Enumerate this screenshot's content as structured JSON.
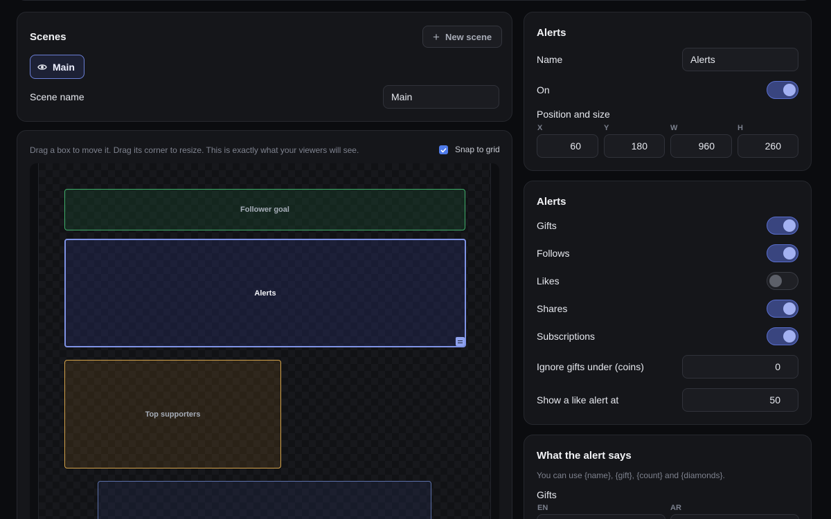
{
  "scenes": {
    "title": "Scenes",
    "new_scene_label": "New scene",
    "active_scene": "Main",
    "scene_name_label": "Scene name",
    "scene_name_value": "Main"
  },
  "editor": {
    "hint": "Drag a box to move it. Drag its corner to resize. This is exactly what your viewers will see.",
    "snap_label": "Snap to grid",
    "snap_checked": true,
    "boxes": {
      "follower_goal": "Follower goal",
      "alerts": "Alerts",
      "top_supporters": "Top supporters"
    }
  },
  "widget": {
    "title": "Alerts",
    "name_label": "Name",
    "name_value": "Alerts",
    "on_label": "On",
    "on_value": true,
    "position_label": "Position and size",
    "x_label": "X",
    "x_value": "60",
    "y_label": "Y",
    "y_value": "180",
    "w_label": "W",
    "w_value": "960",
    "h_label": "H",
    "h_value": "260"
  },
  "alerts": {
    "title": "Alerts",
    "toggles": [
      {
        "label": "Gifts",
        "on": true
      },
      {
        "label": "Follows",
        "on": true
      },
      {
        "label": "Likes",
        "on": false
      },
      {
        "label": "Shares",
        "on": true
      },
      {
        "label": "Subscriptions",
        "on": true
      }
    ],
    "ignore_label": "Ignore gifts under (coins)",
    "ignore_value": "0",
    "like_label": "Show a like alert at",
    "like_value": "50"
  },
  "message": {
    "title": "What the alert says",
    "hint": "You can use {name}, {gift}, {count} and {diamonds}.",
    "gifts_label": "Gifts",
    "lang_en": "EN",
    "lang_ar": "AR"
  },
  "colors": {
    "accent": "#6b7fd6",
    "goal_box": "#3fae6a",
    "supporters_box": "#d3a24a"
  }
}
